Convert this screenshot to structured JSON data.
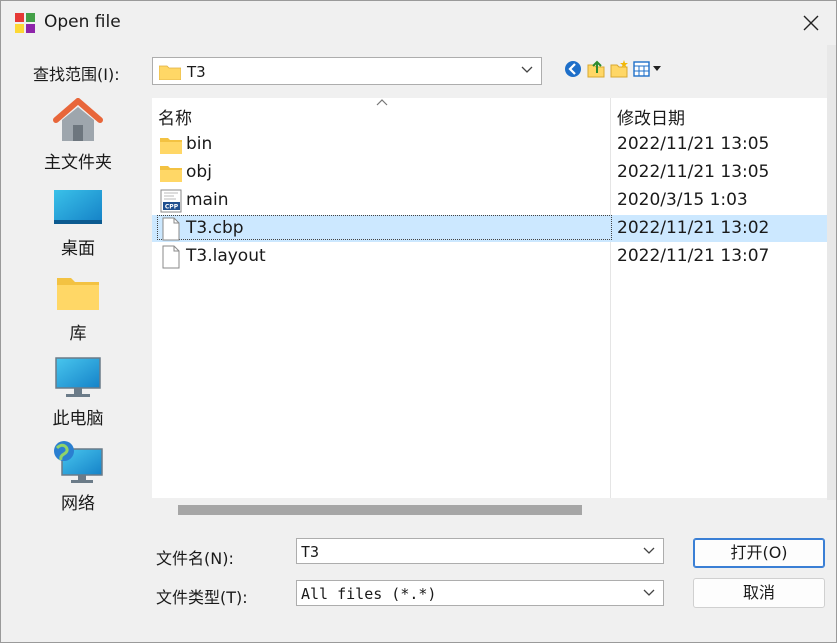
{
  "window": {
    "title": "Open file"
  },
  "lookin": {
    "label": "查找范围(I):",
    "value": "T3"
  },
  "places": [
    {
      "label": "主文件夹",
      "icon": "home-icon"
    },
    {
      "label": "桌面",
      "icon": "desktop-icon"
    },
    {
      "label": "库",
      "icon": "library-folder-icon"
    },
    {
      "label": "此电脑",
      "icon": "computer-icon"
    },
    {
      "label": "网络",
      "icon": "network-icon"
    }
  ],
  "filelist": {
    "columns": [
      "名称",
      "修改日期"
    ],
    "rows": [
      {
        "name": "bin",
        "date": "2022/11/21 13:05",
        "type": "folder"
      },
      {
        "name": "obj",
        "date": "2022/11/21 13:05",
        "type": "folder"
      },
      {
        "name": "main",
        "date": "2020/3/15 1:03",
        "type": "cpp-file"
      },
      {
        "name": "T3.cbp",
        "date": "2022/11/21 13:02",
        "type": "file",
        "selected": true
      },
      {
        "name": "T3.layout",
        "date": "2022/11/21 13:07",
        "type": "file"
      }
    ]
  },
  "filename": {
    "label": "文件名(N):",
    "value": "T3"
  },
  "filetype": {
    "label": "文件类型(T):",
    "value": "All files (*.*)"
  },
  "buttons": {
    "open": "打开(O)",
    "cancel": "取消"
  },
  "colors": {
    "selection": "#cce8ff",
    "folder": "#ffd766",
    "accent": "#3a7fd5"
  }
}
